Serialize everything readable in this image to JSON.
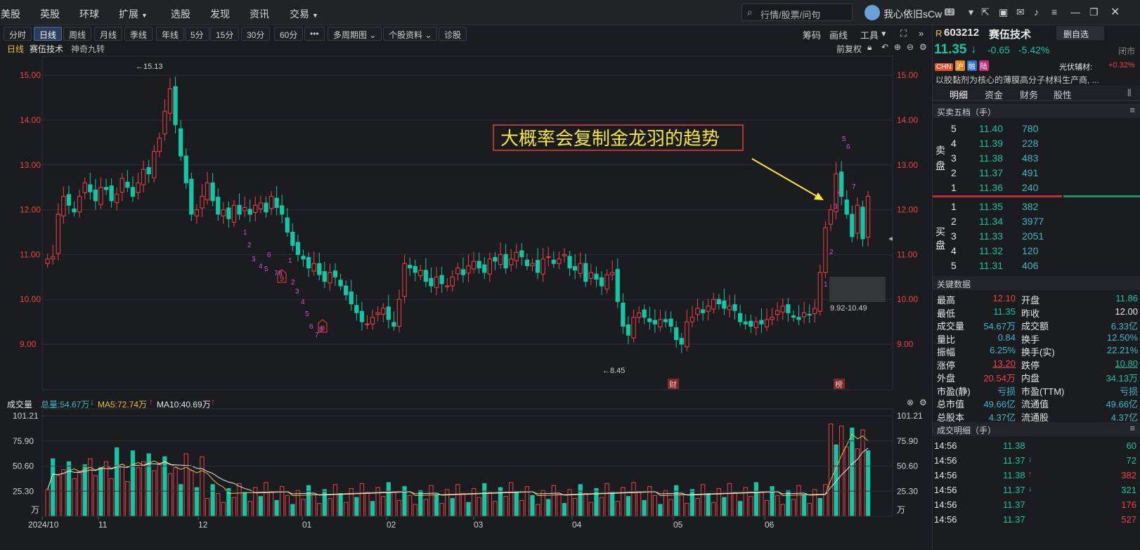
{
  "nav": {
    "items": [
      {
        "label": "美股"
      },
      {
        "label": "英股"
      },
      {
        "label": "环球"
      },
      {
        "label": "扩展",
        "dropdown": true
      },
      {
        "label": "选股"
      },
      {
        "label": "发现"
      },
      {
        "label": "资讯"
      },
      {
        "label": "交易",
        "dropdown": true
      }
    ],
    "search_placeholder": "行情/股票/问句",
    "user_name": "我心依旧sCw",
    "user_level": "L2"
  },
  "toolbar": {
    "periods": [
      "分时",
      "日线",
      "周线",
      "月线",
      "季线",
      "年线",
      "5分",
      "15分",
      "30分",
      "60分",
      "•••"
    ],
    "active": "日线",
    "dropdowns": [
      "多周期图",
      "个股资料"
    ],
    "diag": "诊股",
    "right": [
      "筹码",
      "画线",
      "工具"
    ]
  },
  "titlebar": {
    "period": "日线",
    "name": "赛伍技术",
    "indicator": "神奇九转",
    "fuquan": "前复权"
  },
  "annotation": {
    "text": "大概率会复制金龙羽的趋势",
    "range_label": "9.92-10.49",
    "high_label": "←15.13",
    "low_label": "←8.45",
    "cai_label": "财",
    "bang_label": "榜"
  },
  "volume": {
    "title": "成交量",
    "total_label": "总量:54.67万",
    "ma5_label": "MA5:72.74万",
    "ma10_label": "MA10:40.69万",
    "unit": "万"
  },
  "colors": {
    "up": "#f0414a",
    "down": "#17c4a3",
    "ma5": "#e6c04a",
    "ma10": "#e8e8e8",
    "annot": "#f5e642",
    "grid": "#2c2d33",
    "bg": "#1b1c20"
  },
  "chart_data": {
    "type": "candlestick",
    "price_axis": {
      "min": 9,
      "max": 15,
      "ticks": [
        "15.00",
        "14.00",
        "13.00",
        "12.00",
        "11.00",
        "10.00",
        "9.00"
      ]
    },
    "volume_axis": {
      "ticks": [
        "101.21",
        "75.90",
        "50.60",
        "25.30"
      ]
    },
    "x_labels": [
      "2024/10",
      "11",
      "12",
      "01",
      "02",
      "03",
      "04",
      "05",
      "06"
    ],
    "high": 15.13,
    "low": 8.45
  },
  "quote": {
    "flag": "R",
    "code": "603212",
    "name": "赛伍技术",
    "watch_btn": "删自选",
    "price": "11.35",
    "arrow": "↓",
    "change": "-0.65",
    "pct": "-5.42%",
    "status": "闭市",
    "tags": [
      {
        "t": "CHN",
        "c": "#e0552b"
      },
      {
        "t": "沪",
        "c": "#e08a1b"
      },
      {
        "t": "融",
        "c": "#2f6fd0"
      },
      {
        "t": "陆",
        "c": "#c02f7a"
      }
    ],
    "sector": "光伏辅材:",
    "sector_pct": "+0.32%",
    "desc": "以胶黏剂为核心的薄膜高分子材料生产商, ..."
  },
  "tabs": [
    "明细",
    "资金",
    "财务",
    "股性"
  ],
  "orderbook": {
    "title": "买卖五档（手）",
    "sell_label": [
      "卖",
      "盘"
    ],
    "buy_label": [
      "买",
      "盘"
    ],
    "asks": [
      {
        "l": "5",
        "p": "11.40",
        "v": "780"
      },
      {
        "l": "4",
        "p": "11.39",
        "v": "228"
      },
      {
        "l": "3",
        "p": "11.38",
        "v": "483"
      },
      {
        "l": "2",
        "p": "11.37",
        "v": "491"
      },
      {
        "l": "1",
        "p": "11.36",
        "v": "240"
      }
    ],
    "bids": [
      {
        "l": "1",
        "p": "11.35",
        "v": "382"
      },
      {
        "l": "2",
        "p": "11.34",
        "v": "3977"
      },
      {
        "l": "3",
        "p": "11.33",
        "v": "2051"
      },
      {
        "l": "4",
        "p": "11.32",
        "v": "120"
      },
      {
        "l": "5",
        "p": "11.31",
        "v": "406"
      }
    ]
  },
  "keydata": {
    "title": "关键数据",
    "rows": [
      {
        "k": "最高",
        "v": "12.10",
        "vc": "r",
        "k2": "开盘",
        "v2": "11.86",
        "v2c": "g"
      },
      {
        "k": "最低",
        "v": "11.35",
        "vc": "g",
        "k2": "昨收",
        "v2": "12.00",
        "v2c": "w"
      },
      {
        "k": "成交量",
        "v": "54.67万",
        "vc": "c",
        "k2": "成交额",
        "v2": "6.33亿",
        "v2c": "c"
      },
      {
        "k": "量比",
        "v": "0.84",
        "vc": "c",
        "k2": "换手",
        "v2": "12.50%",
        "v2c": "c"
      },
      {
        "k": "振幅",
        "v": "6.25%",
        "vc": "c",
        "k2": "换手(实)",
        "v2": "22.21%",
        "v2c": "c"
      },
      {
        "k": "涨停",
        "v": "13.20",
        "vc": "r",
        "k2": "跌停",
        "v2": "10.80",
        "v2c": "g"
      },
      {
        "k": "外盘",
        "v": "20.54万",
        "vc": "r",
        "k2": "内盘",
        "v2": "34.13万",
        "v2c": "g"
      },
      {
        "k": "市盈(静)",
        "v": "亏损",
        "vc": "c",
        "k2": "市盈(TTM)",
        "v2": "亏损",
        "v2c": "c"
      },
      {
        "k": "总市值",
        "v": "49.66亿",
        "vc": "c",
        "k2": "流通值",
        "v2": "49.66亿",
        "v2c": "c"
      },
      {
        "k": "总股本",
        "v": "4.37亿",
        "vc": "c",
        "k2": "流通股",
        "v2": "4.37亿",
        "v2c": "c"
      }
    ]
  },
  "trades": {
    "title": "成交明细（手）",
    "rows": [
      {
        "t": "14:56",
        "p": "11.38",
        "a": "",
        "v": "60",
        "vc": "g"
      },
      {
        "t": "14:56",
        "p": "11.37",
        "a": "↓",
        "v": "72",
        "vc": "g"
      },
      {
        "t": "14:56",
        "p": "11.38",
        "a": "↑",
        "v": "382",
        "vc": "r"
      },
      {
        "t": "14:56",
        "p": "11.37",
        "a": "↓",
        "v": "321",
        "vc": "g"
      },
      {
        "t": "14:56",
        "p": "11.37",
        "a": "",
        "v": "176",
        "vc": "r"
      },
      {
        "t": "14:56",
        "p": "11.37",
        "a": "",
        "v": "527",
        "vc": "r"
      }
    ]
  }
}
